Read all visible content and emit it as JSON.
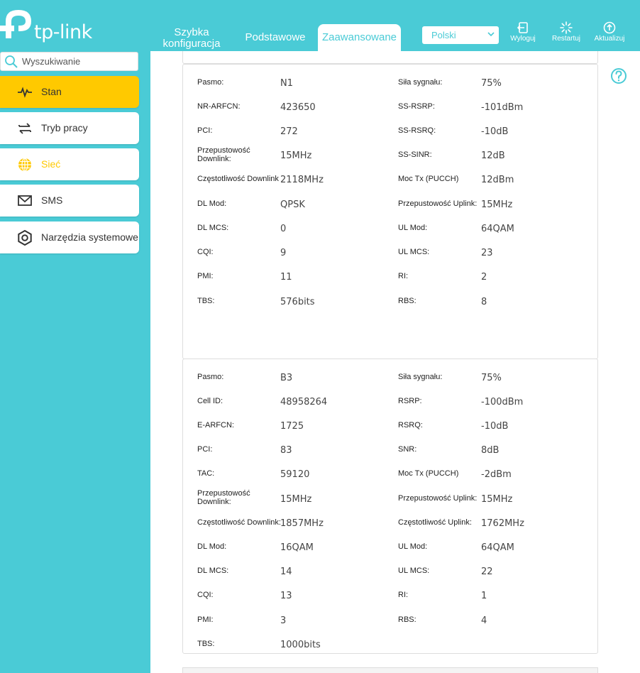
{
  "header": {
    "logo_text": "tp-link",
    "tabs": [
      {
        "label_line1": "Szybka",
        "label_line2": "konfiguracja"
      },
      {
        "label": "Podstawowe"
      },
      {
        "label": "Zaawansowane"
      }
    ],
    "language": "Polski",
    "buttons": {
      "logout": "Wyloguj",
      "restart": "Restartuj",
      "update": "Aktualizuj"
    }
  },
  "search": {
    "placeholder": "Wyszukiwanie"
  },
  "sidebar": {
    "items": [
      {
        "label": "Stan"
      },
      {
        "label": "Tryb pracy"
      },
      {
        "label": "Sieć"
      },
      {
        "label": "SMS"
      },
      {
        "label": "Narzędzia systemowe"
      }
    ]
  },
  "colors": {
    "accent": "#4acbd6",
    "active": "#ffc900"
  },
  "nr_card": {
    "rows": [
      {
        "k1": "Pasmo:",
        "v1": "N1",
        "k2": "Siła sygnału:",
        "v2": "75%"
      },
      {
        "k1": "NR-ARFCN:",
        "v1": "423650",
        "k2": "SS-RSRP:",
        "v2": "-101dBm"
      },
      {
        "k1": "PCI:",
        "v1": "272",
        "k2": "SS-RSRQ:",
        "v2": "-10dB"
      },
      {
        "k1": "Przepustowość Downlink:",
        "v1": "15MHz",
        "k2": "SS-SINR:",
        "v2": "12dB"
      },
      {
        "k1": "Częstotliwość Downlink",
        "v1": "2118MHz",
        "k2": "Moc Tx (PUCCH)",
        "v2": "12dBm"
      },
      {
        "k1": "DL Mod:",
        "v1": "QPSK",
        "k2": "Przepustowość Uplink:",
        "v2": "15MHz"
      },
      {
        "k1": "DL MCS:",
        "v1": "0",
        "k2": "UL Mod:",
        "v2": "64QAM"
      },
      {
        "k1": "CQI:",
        "v1": "9",
        "k2": "UL MCS:",
        "v2": "23"
      },
      {
        "k1": "PMI:",
        "v1": "11",
        "k2": "RI:",
        "v2": "2"
      },
      {
        "k1": "TBS:",
        "v1": "576bits",
        "k2": "RBS:",
        "v2": "8"
      }
    ]
  },
  "lte_card": {
    "rows": [
      {
        "k1": "Pasmo:",
        "v1": "B3",
        "k2": "Siła sygnału:",
        "v2": "75%"
      },
      {
        "k1": "Cell ID:",
        "v1": "48958264",
        "k2": "RSRP:",
        "v2": "-100dBm"
      },
      {
        "k1": "E-ARFCN:",
        "v1": "1725",
        "k2": "RSRQ:",
        "v2": "-10dB"
      },
      {
        "k1": "PCI:",
        "v1": "83",
        "k2": "SNR:",
        "v2": "8dB"
      },
      {
        "k1": "TAC:",
        "v1": "59120",
        "k2": "Moc Tx (PUCCH)",
        "v2": "-2dBm"
      },
      {
        "k1": "Przepustowość Downlink:",
        "v1": "15MHz",
        "k2": "Przepustowość Uplink:",
        "v2": "15MHz"
      },
      {
        "k1": "Częstotliwość Downlink:",
        "v1": "1857MHz",
        "k2": "Częstotliwość Uplink:",
        "v2": "1762MHz"
      },
      {
        "k1": "DL Mod:",
        "v1": "16QAM",
        "k2": "UL Mod:",
        "v2": "64QAM"
      },
      {
        "k1": "DL MCS:",
        "v1": "14",
        "k2": "UL MCS:",
        "v2": "22"
      },
      {
        "k1": "CQI:",
        "v1": "13",
        "k2": "RI:",
        "v2": "1"
      },
      {
        "k1": "PMI:",
        "v1": "3",
        "k2": "RBS:",
        "v2": "4"
      },
      {
        "k1": "TBS:",
        "v1": "1000bits",
        "k2": "",
        "v2": ""
      }
    ]
  }
}
